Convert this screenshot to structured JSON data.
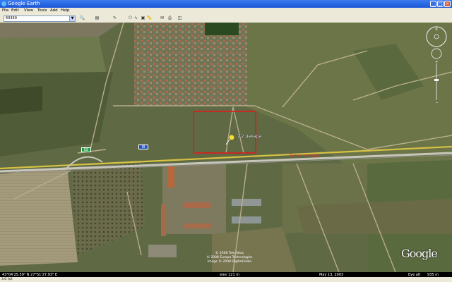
{
  "window": {
    "title": "Google Earth",
    "minimize": "_",
    "maximize": "□",
    "close": "×"
  },
  "menu": [
    "File",
    "Edit",
    "View",
    "Tools",
    "Add",
    "Help"
  ],
  "search": {
    "value": "69369"
  },
  "map": {
    "placemark_label": "7,2 декара",
    "road_shield_e": "E8",
    "road_shield_i": "I8",
    "road_name": "Бетон пътище",
    "credits": [
      "© 2008 Tele Atlas",
      "© 2008 Europa Technologies",
      "Image © 2008 DigitalGlobe"
    ],
    "brand": "Google"
  },
  "status": {
    "coords": "43°04'25.59\" N   27°51'27.93\" E",
    "elev": "elev 121 m",
    "date": "May 13, 2003",
    "eye_alt": "Eye alt",
    "eye_alt_value": "935 m",
    "loading": "3.0 (sl)"
  },
  "colors": {
    "selection_box": "#e01b1b",
    "road_label": "#ff2a2a",
    "road_yellow": "#d8c244"
  }
}
